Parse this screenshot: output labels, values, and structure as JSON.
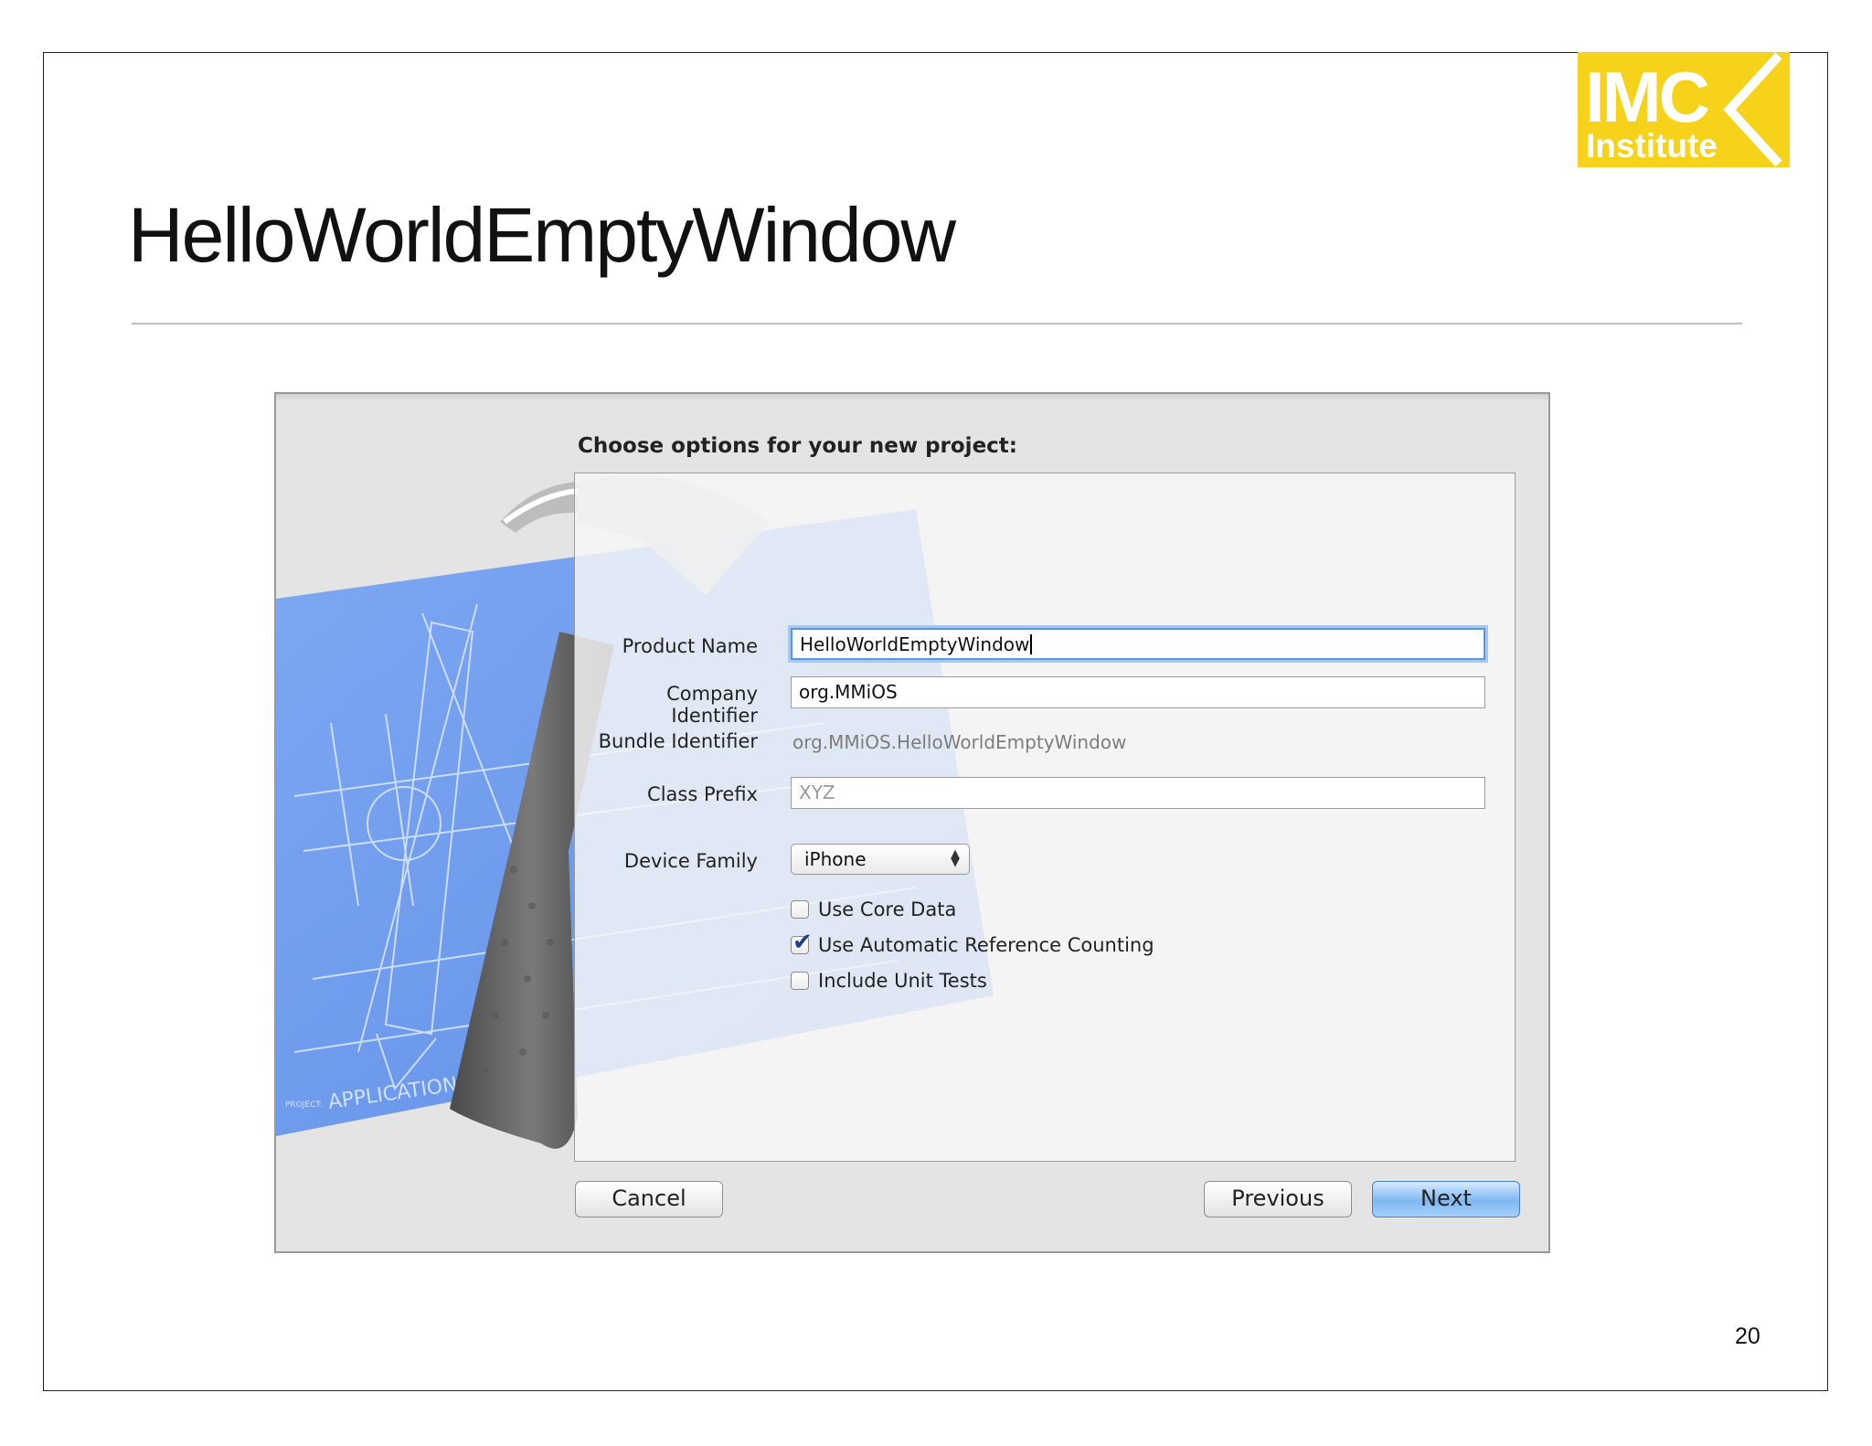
{
  "slide": {
    "title": "HelloWorldEmptyWindow",
    "page_number": "20"
  },
  "logo": {
    "line1": "IMC",
    "line2": "Institute",
    "color": "#f7d21a"
  },
  "dialog": {
    "heading": "Choose options for your new project:",
    "fields": {
      "product_name": {
        "label": "Product Name",
        "value": "HelloWorldEmptyWindow"
      },
      "company_identifier": {
        "label": "Company Identifier",
        "value": "org.MMiOS"
      },
      "bundle_identifier": {
        "label": "Bundle Identifier",
        "value": "org.MMiOS.HelloWorldEmptyWindow"
      },
      "class_prefix": {
        "label": "Class Prefix",
        "placeholder": "XYZ"
      },
      "device_family": {
        "label": "Device Family",
        "selected": "iPhone"
      }
    },
    "checkboxes": [
      {
        "label": "Use Core Data",
        "checked": false
      },
      {
        "label": "Use Automatic Reference Counting",
        "checked": true
      },
      {
        "label": "Include Unit Tests",
        "checked": false
      }
    ],
    "buttons": {
      "cancel": "Cancel",
      "previous": "Previous",
      "next": "Next"
    },
    "artwork_text": "APPLICATION",
    "icons": {
      "checkmark": "checkmark-icon",
      "popup_arrows": "updown-arrows-icon"
    }
  }
}
